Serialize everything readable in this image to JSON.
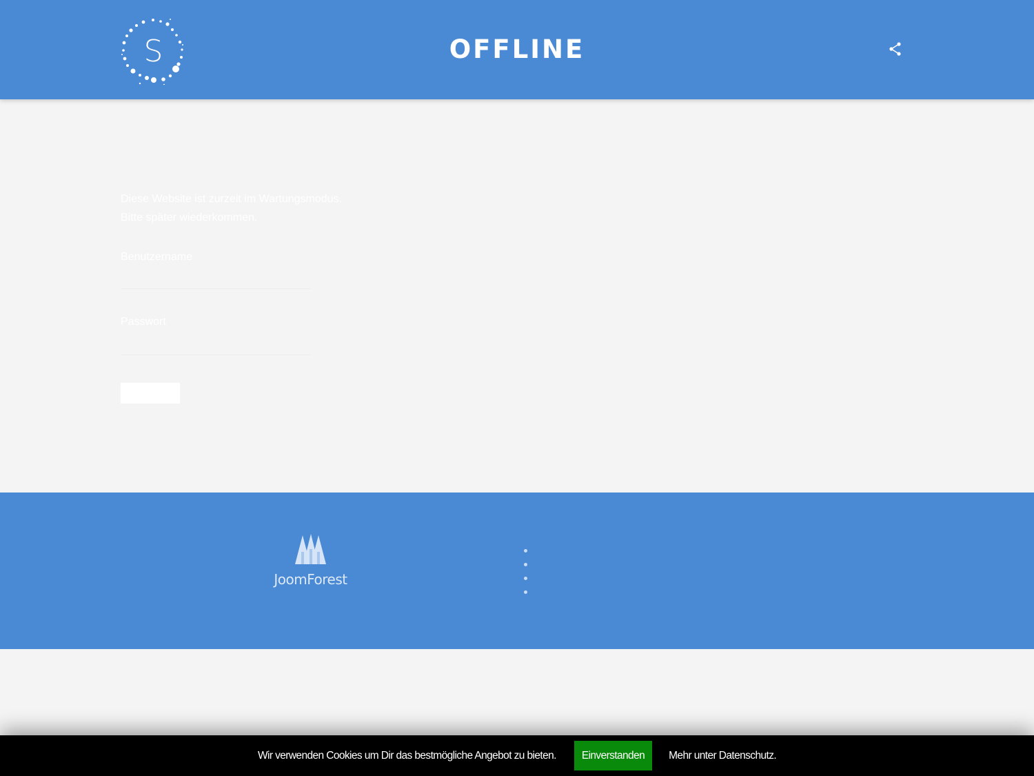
{
  "header": {
    "logo_letter": "S",
    "title": "OFFLINE",
    "share_icon": "share-icon"
  },
  "main": {
    "message_line1": "Diese Website ist zurzeit im Wartungsmodus.",
    "message_line2": "Bitte später wiederkommen.",
    "username_label": "Benutzername",
    "username_value": "",
    "password_label": "Passwort",
    "password_value": "",
    "login_button_label": ""
  },
  "footer": {
    "brand": "JoomForest",
    "brand_icon": "trees-icon"
  },
  "cookie": {
    "text": "Wir verwenden Cookies um Dir das bestmögliche Angebot zu bieten.",
    "accept_label": "Einverstanden",
    "more_label": "Mehr unter Datenschutz."
  },
  "colors": {
    "brand_blue": "#4a89d3",
    "background": "#f4f4f4",
    "accept_green": "#0a8a0a",
    "cookie_bar": "#000000"
  }
}
